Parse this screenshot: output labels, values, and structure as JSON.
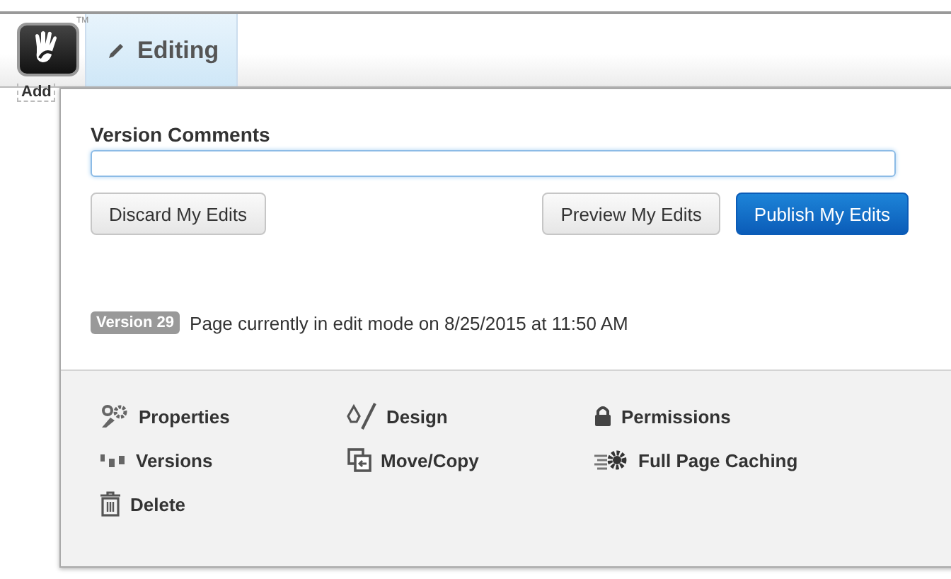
{
  "toolbar": {
    "trademark": "TM",
    "tabs": [
      {
        "label": "Editing",
        "selected": true
      }
    ]
  },
  "page": {
    "add_text": "Add"
  },
  "panel": {
    "comments_label": "Version Comments",
    "left_buttons": [
      {
        "label": "Discard My Edits",
        "kind": "default"
      }
    ],
    "right_buttons": [
      {
        "label": "Preview My Edits",
        "kind": "default"
      },
      {
        "label": "Publish My Edits",
        "kind": "primary"
      }
    ],
    "version_badge": "Version 29",
    "status": "Page currently in edit mode on 8/25/2015 at 11:50 AM",
    "actions": [
      {
        "label": "Properties"
      },
      {
        "label": "Design"
      },
      {
        "label": "Permissions"
      },
      {
        "label": "Versions"
      },
      {
        "label": "Move/Copy"
      },
      {
        "label": "Full Page Caching"
      },
      {
        "label": "Delete"
      }
    ]
  }
}
